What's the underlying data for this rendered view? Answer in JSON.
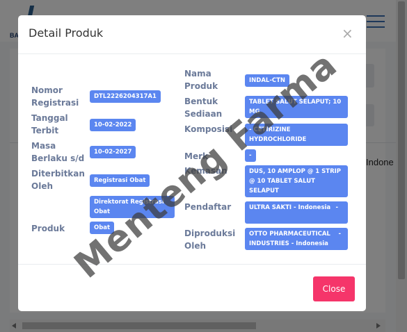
{
  "background": {
    "logo_text": "BA",
    "side_text": "Indone"
  },
  "modal": {
    "title": "Detail Produk",
    "close_icon": "close-icon",
    "close_button_label": "Close"
  },
  "left_fields": [
    {
      "label": "Nomor Registrasi",
      "value": "DTL2226204317A1"
    },
    {
      "label": "Tanggal Terbit",
      "value": "10-02-2022"
    },
    {
      "label": "Masa Berlaku s/d",
      "value": "10-02-2027"
    },
    {
      "label": "Diterbitkan Oleh",
      "value": "Registrasi Obat"
    },
    {
      "label": "",
      "value": "Direktorat Registrasi Obat"
    },
    {
      "label": "Produk",
      "value": "Obat"
    }
  ],
  "right_fields": [
    {
      "label": "Nama Produk",
      "value": "INDAL-CTN"
    },
    {
      "label": "Bentuk Sediaan",
      "value": "TABLET SALUT SELAPUT; 10 MG"
    },
    {
      "label": "Komposisi",
      "value": "- CETIRIZINE HYDROCHLORIDE"
    },
    {
      "label": "Merk",
      "value": "-"
    },
    {
      "label": "Kemasan",
      "value": "DUS, 10 AMPLOP @ 1 STRIP @ 10 TABLET SALUT SELAPUT"
    },
    {
      "label": "Pendaftar",
      "value": "ULTRA SAKTI - Indonesia",
      "suffix": "-"
    },
    {
      "label": "Diproduksi Oleh",
      "value": "OTTO PHARMACEUTICAL INDUSTRIES - Indonesia",
      "suffix": "-"
    }
  ],
  "watermark": "Menteng Farma",
  "colors": {
    "badge": "#5b86f0",
    "close_button": "#f5356a",
    "label": "#6b7a99"
  }
}
